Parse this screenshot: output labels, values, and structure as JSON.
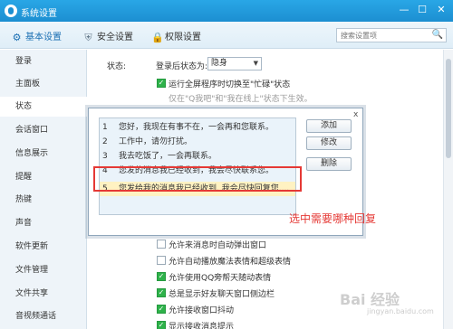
{
  "window": {
    "title": "系统设置",
    "minimize": "—",
    "maximize": "☐",
    "close": "✕"
  },
  "tabs": [
    {
      "label": "基本设置",
      "icon": "gear-icon",
      "glyph": "⚙"
    },
    {
      "label": "安全设置",
      "icon": "shield-icon",
      "glyph": "⛨"
    },
    {
      "label": "权限设置",
      "icon": "lock-icon",
      "glyph": "🔒"
    }
  ],
  "search": {
    "placeholder": "搜索设置项",
    "icon": "🔍"
  },
  "sidebar": {
    "items": [
      {
        "label": "登录"
      },
      {
        "label": "主面板"
      },
      {
        "label": "状态"
      },
      {
        "label": "会话窗口"
      },
      {
        "label": "信息展示"
      },
      {
        "label": "提醒"
      },
      {
        "label": "热键"
      },
      {
        "label": "声音"
      },
      {
        "label": "软件更新"
      },
      {
        "label": "文件管理"
      },
      {
        "label": "文件共享"
      },
      {
        "label": "音视频通话"
      }
    ]
  },
  "status_section": {
    "label": "状态:",
    "login_status_label": "登录后状态为:",
    "login_status_value": "隐身",
    "fullscreen_option": "运行全屏程序时切换至\"忙碌\"状态",
    "fullscreen_hint": "仅在\"Q我吧\"和\"我在线上\"状态下生效。"
  },
  "reply_dialog": {
    "close": "x",
    "rows": [
      {
        "num": "1",
        "text": "您好，我现在有事不在，一会再和您联系。"
      },
      {
        "num": "2",
        "text": "工作中，请勿打扰。"
      },
      {
        "num": "3",
        "text": "我去吃饭了，一会再联系。"
      },
      {
        "num": "4",
        "text": "您发的消息我已经收到，我会尽快联系您。"
      },
      {
        "num": "5",
        "text": "您发给我的消息我已经收到, 我会尽快回复您...."
      }
    ],
    "add_button": "添加",
    "edit_button": "修改",
    "delete_button": "删除"
  },
  "options": [
    {
      "label": "允许来消息时自动弹出窗口",
      "checked": false
    },
    {
      "label": "允许自动播放魔法表情和超级表情",
      "checked": false
    },
    {
      "label": "允许使用QQ旁帮天随动表情",
      "checked": true
    },
    {
      "label": "总是显示好友聊天窗口侧边栏",
      "checked": true
    },
    {
      "label": "允许接收窗口抖动",
      "checked": true
    },
    {
      "label": "显示接收消息提示",
      "checked": true
    }
  ],
  "annotation": "选中需要哪种回复",
  "watermark": {
    "brand": "Bai 经验",
    "url": "jingyan.baidu.com"
  },
  "colors": {
    "titlebar": "#1c8fd1",
    "selected_row": "#fff2c2",
    "annotation_red": "#e53935",
    "check_green": "#2eb24a"
  }
}
